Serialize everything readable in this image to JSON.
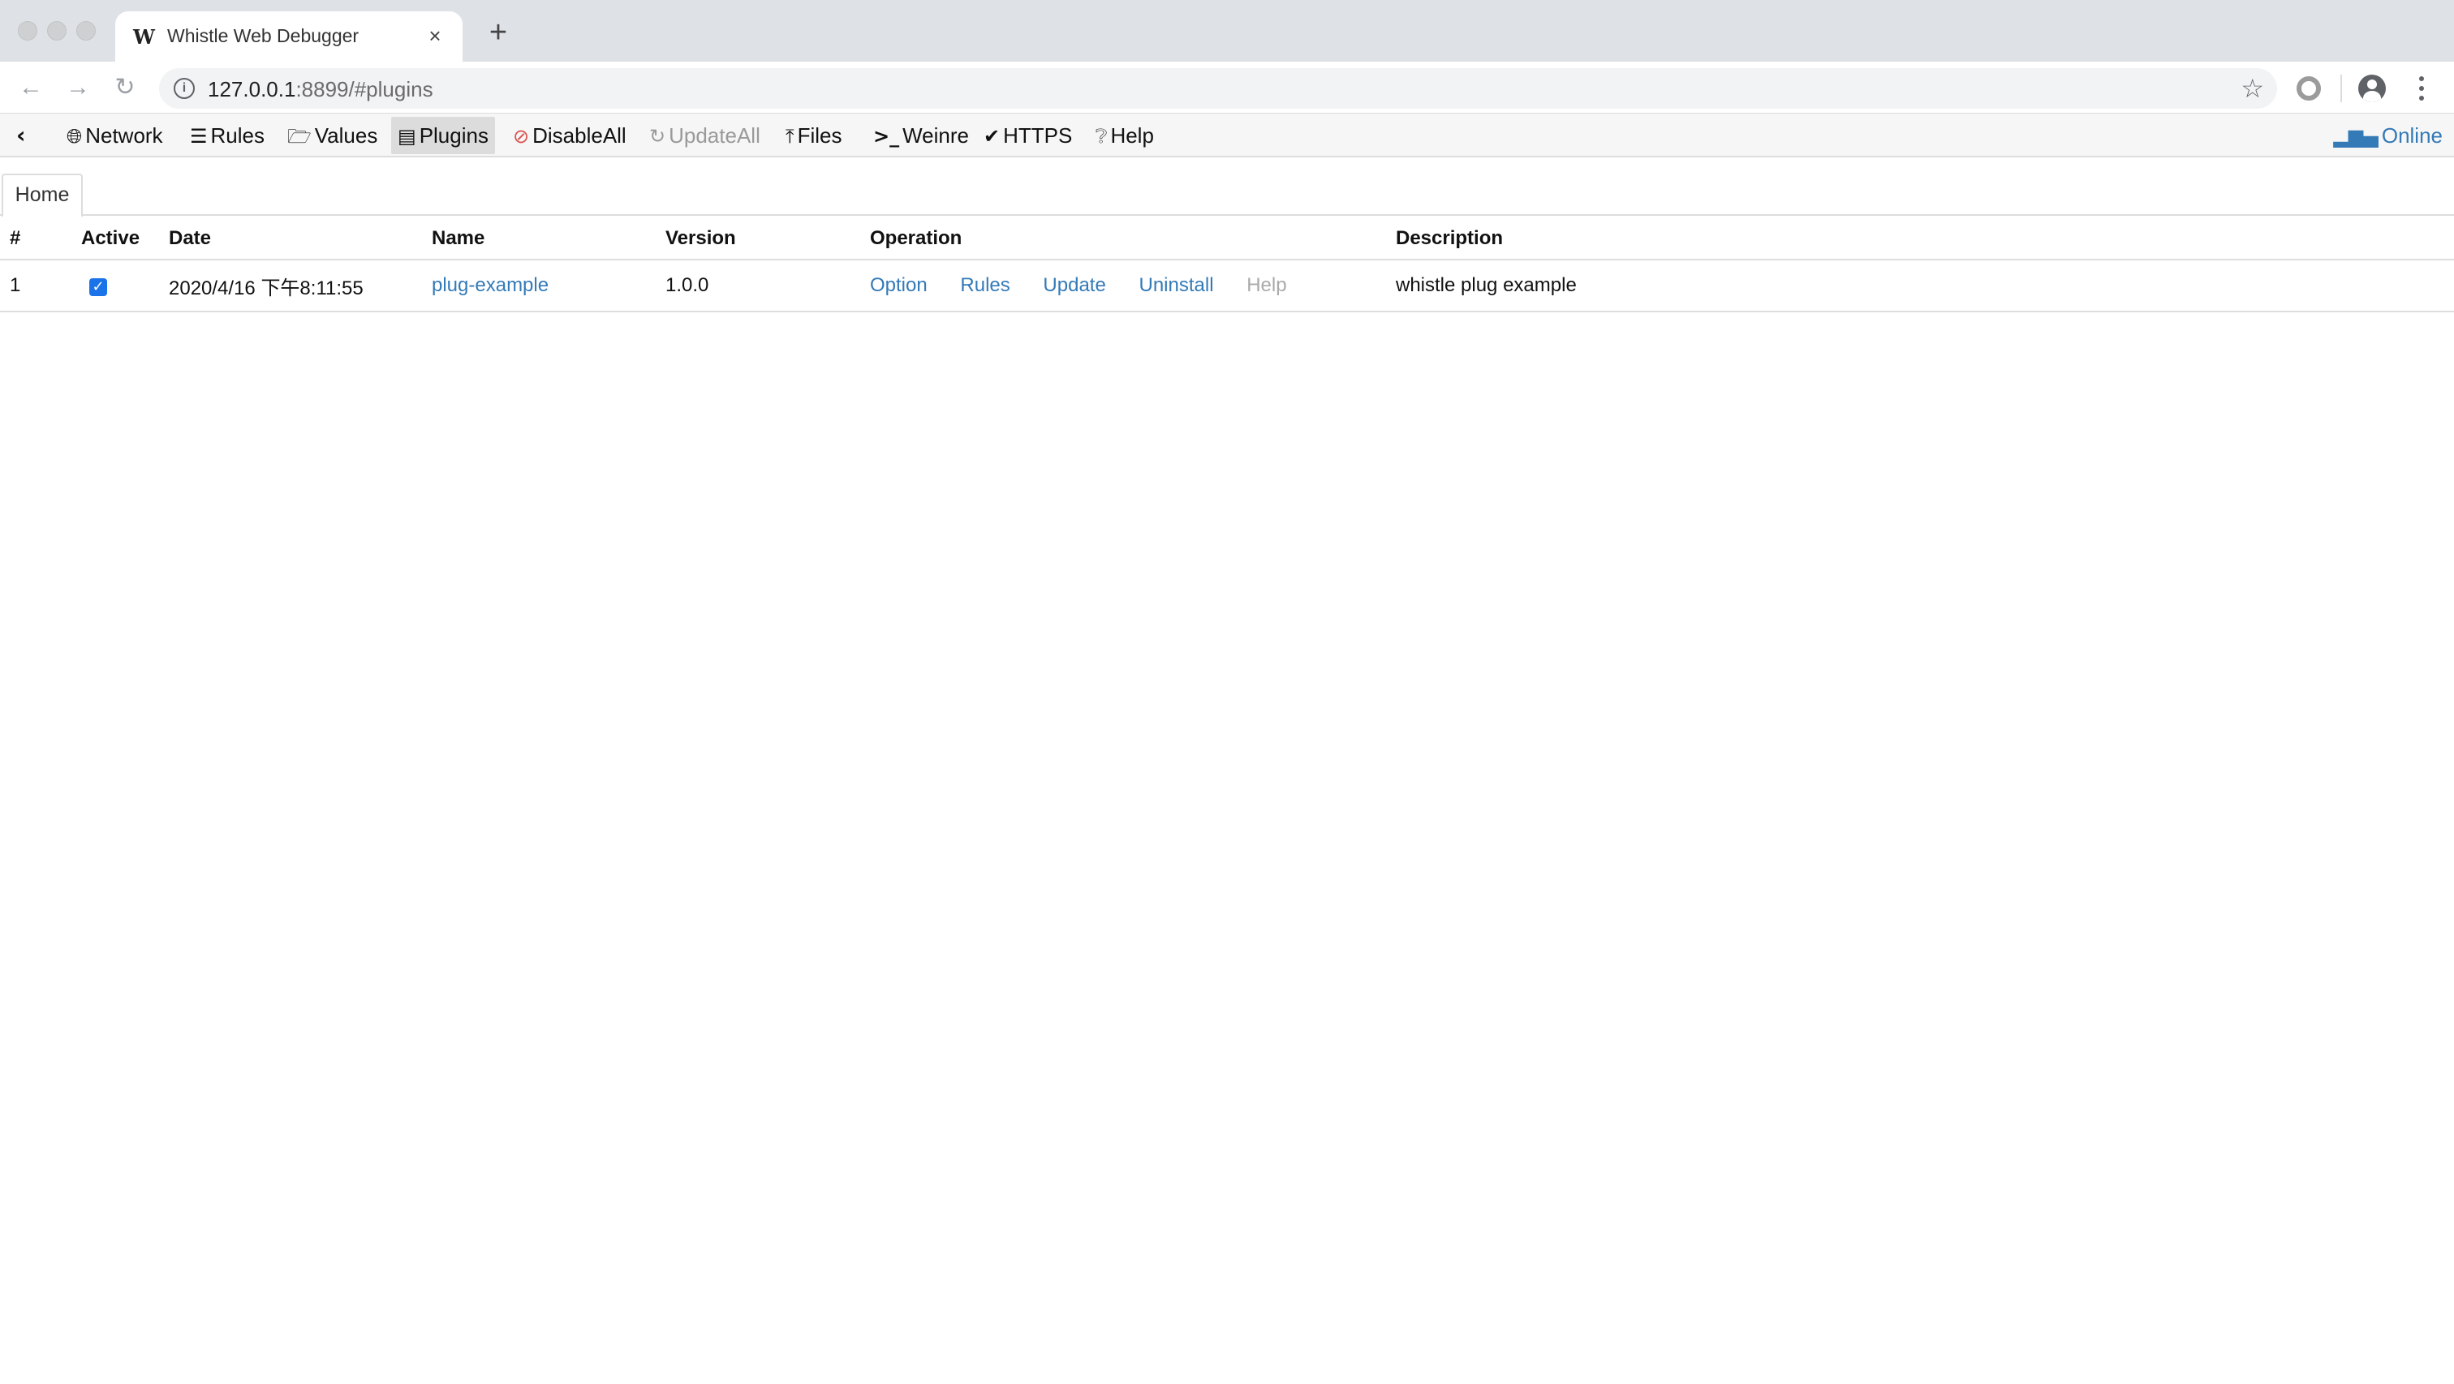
{
  "browser": {
    "tab_title": "Whistle Web Debugger",
    "tab_favicon": "W",
    "tab_close": "×",
    "new_tab": "+",
    "url_host": "127.0.0.1",
    "url_rest": ":8899/#plugins",
    "icons": {
      "back": "back-arrow-icon",
      "forward": "forward-arrow-icon",
      "reload": "reload-icon",
      "info": "info-icon",
      "star": "star-icon",
      "extension": "extension-icon",
      "profile": "profile-avatar-icon",
      "menu": "kebab-menu-icon"
    }
  },
  "appbar": {
    "items": [
      {
        "label": "Network",
        "icon": "globe-icon"
      },
      {
        "label": "Rules",
        "icon": "list-icon"
      },
      {
        "label": "Values",
        "icon": "folder-icon"
      },
      {
        "label": "Plugins",
        "icon": "plugin-icon",
        "active": true
      },
      {
        "label": "DisableAll",
        "icon": "ban-icon"
      },
      {
        "label": "UpdateAll",
        "icon": "refresh-icon",
        "disabled": true
      },
      {
        "label": "Files",
        "icon": "upload-icon"
      },
      {
        "label": "Weinre",
        "icon": "terminal-icon"
      },
      {
        "label": "HTTPS",
        "icon": "check-icon"
      },
      {
        "label": "Help",
        "icon": "help-icon"
      }
    ],
    "online_label": "Online",
    "accent_color": "#337ab7",
    "danger_color": "#d9534f"
  },
  "content": {
    "tabs": [
      {
        "label": "Home"
      }
    ],
    "table": {
      "headers": [
        "#",
        "Active",
        "Date",
        "Name",
        "Version",
        "Operation",
        "Description"
      ],
      "rows": [
        {
          "num": "1",
          "active": true,
          "date": "2020/4/16 下午8:11:55",
          "name": "plug-example",
          "version": "1.0.0",
          "operations": [
            "Option",
            "Rules",
            "Update",
            "Uninstall",
            "Help"
          ],
          "description": "whistle plug example"
        }
      ]
    }
  }
}
